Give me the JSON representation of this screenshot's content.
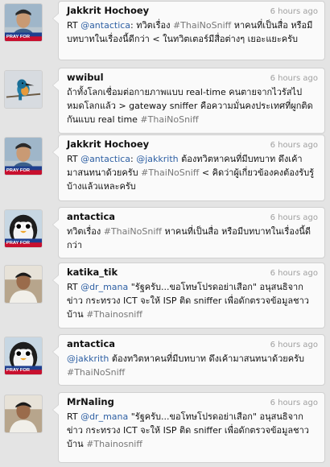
{
  "tweets": [
    {
      "user": "Jakkrit Hochoey",
      "time": "6 hours ago",
      "avatar": "person-photo-pray-for-haiti",
      "parts": [
        {
          "t": "RT ",
          "k": "text"
        },
        {
          "t": "@antactica",
          "k": "mention"
        },
        {
          "t": ": ทวิตเรื่อง  ",
          "k": "text"
        },
        {
          "t": "#ThaiNoSniff",
          "k": "hashtag"
        },
        {
          "t": " หาคนที่เป็นสื่อ หรือมีบทบาทในเรื่องนี้ดีกว่า < ในทวิตเตอร์มีสื่อต่างๆ เยอะแยะครับ",
          "k": "text"
        }
      ]
    },
    {
      "user": "wwibul",
      "time": "6 hours ago",
      "avatar": "kingfisher-bird",
      "parts": [
        {
          "t": "ถ้าทั้งโลกเชื่อมต่อกายภาพแบบ real-time คนตายจากไวรัสไปหมดโลกแล้ว > gateway sniffer คือความมั่นคงประเทศที่ผูกติดกันแบบ real time ",
          "k": "text"
        },
        {
          "t": "#ThaiNoSniff",
          "k": "hashtag"
        }
      ]
    },
    {
      "user": "Jakkrit Hochoey",
      "time": "6 hours ago",
      "avatar": "person-photo-pray-for-haiti",
      "parts": [
        {
          "t": "RT ",
          "k": "text"
        },
        {
          "t": "@antactica",
          "k": "mention"
        },
        {
          "t": ": ",
          "k": "text"
        },
        {
          "t": "@jakkrith",
          "k": "mention"
        },
        {
          "t": " ต้องทวิตหาคนที่มีบทบาท ดึงเค้ามาสนทนาด้วยครับ  ",
          "k": "text"
        },
        {
          "t": "#ThaiNoSniff",
          "k": "hashtag"
        },
        {
          "t": " < คิดว่าผู้เกี่ยวข้องคงต้องรับรู้บ้างแล้วแหละครับ",
          "k": "text"
        }
      ]
    },
    {
      "user": "antactica",
      "time": "6 hours ago",
      "avatar": "penguin-pray-for-haiti",
      "parts": [
        {
          "t": "ทวิตเรื่อง  ",
          "k": "text"
        },
        {
          "t": "#ThaiNoSniff",
          "k": "hashtag"
        },
        {
          "t": " หาคนที่เป็นสื่อ หรือมีบทบาทในเรื่องนี้ดีกว่า",
          "k": "text"
        }
      ]
    },
    {
      "user": "katika_tik",
      "time": "6 hours ago",
      "avatar": "person-photo",
      "parts": [
        {
          "t": "RT ",
          "k": "text"
        },
        {
          "t": "@dr_mana",
          "k": "mention"
        },
        {
          "t": " \"รัฐครับ...ขอโทษโปรดอย่าเสือก\" อนุสนธิจากข่าว กระทรวง ICT จะให้ ISP ติด sniffer เพื่อดักตรวจข้อมูลชาวบ้าน ",
          "k": "text"
        },
        {
          "t": "#Thainosniff",
          "k": "hashtag"
        }
      ]
    },
    {
      "user": "antactica",
      "time": "6 hours ago",
      "avatar": "penguin-pray-for-haiti",
      "parts": [
        {
          "t": "@jakkrith",
          "k": "mention"
        },
        {
          "t": " ต้องทวิตหาคนที่มีบทบาท ดึงเค้ามาสนทนาด้วยครับ  ",
          "k": "text"
        },
        {
          "t": "#ThaiNoSniff",
          "k": "hashtag"
        }
      ]
    },
    {
      "user": "MrNaling",
      "time": "6 hours ago",
      "avatar": "person-photo",
      "parts": [
        {
          "t": "RT ",
          "k": "text"
        },
        {
          "t": "@dr_mana",
          "k": "mention"
        },
        {
          "t": " \"รัฐครับ...ขอโทษโปรดอย่าเสือก\" อนุสนธิจากข่าว กระทรวง ICT จะให้ ISP ติด sniffer เพื่อดักตรวจข้อมูลชาวบ้าน ",
          "k": "text"
        },
        {
          "t": "#Thainosniff",
          "k": "hashtag"
        }
      ]
    }
  ],
  "avatar_badge_text": "PRAY FOR",
  "colors": {
    "mention": "#2d5fa3",
    "hashtag": "#777777",
    "timestamp": "#a0a0a0",
    "background": "#e4e4e4",
    "bubble": "#fafafa"
  }
}
